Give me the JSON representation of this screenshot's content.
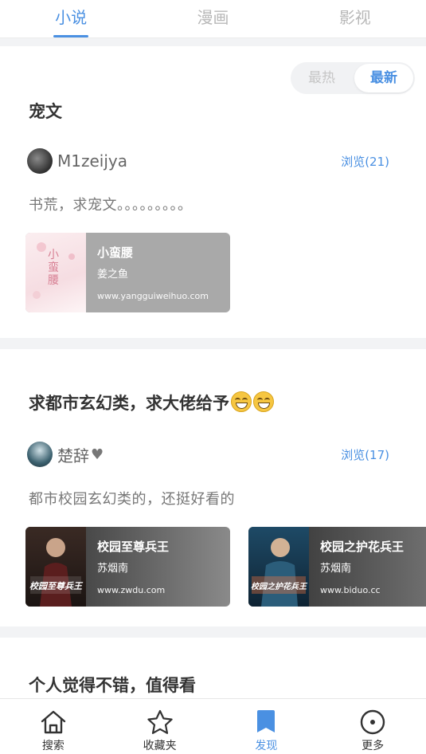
{
  "top_tabs": [
    {
      "label": "小说",
      "active": true
    },
    {
      "label": "漫画",
      "active": false
    },
    {
      "label": "影视",
      "active": false
    }
  ],
  "sort": {
    "hot_label": "最热",
    "new_label": "最新",
    "selected": "最新"
  },
  "posts": [
    {
      "title": "宠文",
      "author": "M1zeijya",
      "views": "浏览(21)",
      "body": "书荒，求宠文。。。。。。。。。",
      "books": [
        {
          "title": "小蛮腰",
          "author": "姜之鱼",
          "site": "www.yangguiweihuo.com",
          "cover_text": "小蛮腰"
        }
      ]
    },
    {
      "title": "求都市玄幻类，求大佬给予",
      "author": "楚辞",
      "views": "浏览(17)",
      "body": "都市校园玄幻类的，还挺好看的",
      "books": [
        {
          "title": "校园至尊兵王",
          "author": "苏烟南",
          "site": "www.zwdu.com",
          "cover_text": "校园至尊兵王"
        },
        {
          "title": "校园之护花兵王",
          "author": "苏烟南",
          "site": "www.biduo.cc",
          "cover_text": "校园之护花兵王"
        }
      ]
    },
    {
      "title": "个人觉得不错，值得看"
    }
  ],
  "bottom_nav": [
    {
      "label": "搜索",
      "icon": "home-icon",
      "active": false
    },
    {
      "label": "收藏夹",
      "icon": "star-icon",
      "active": false
    },
    {
      "label": "发现",
      "icon": "bookmark-icon",
      "active": true
    },
    {
      "label": "更多",
      "icon": "more-circle-icon",
      "active": false
    }
  ],
  "colors": {
    "accent": "#4a90e2",
    "muted": "#b8b8b8"
  }
}
